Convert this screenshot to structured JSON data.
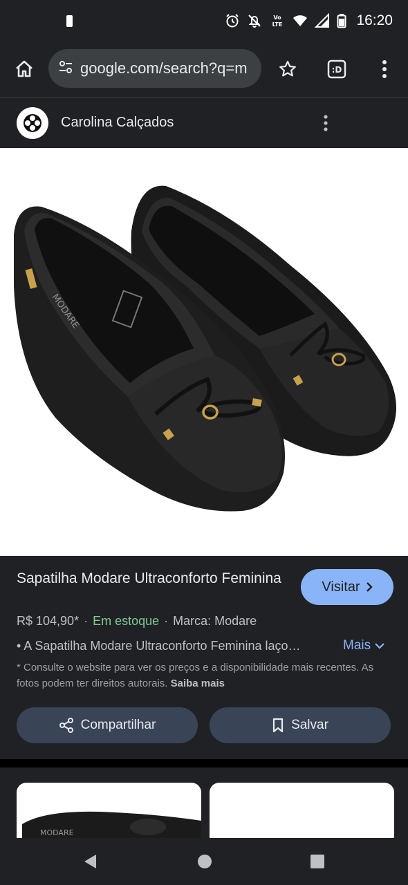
{
  "status_bar": {
    "time": "16:20",
    "network_label": "Vo LTE"
  },
  "browser": {
    "url": "google.com/search?q=m",
    "tab_label": ":D"
  },
  "site": {
    "name": "Carolina Calçados"
  },
  "product": {
    "title": "Sapatilha Modare Ultraconforto Feminina",
    "visit_label": "Visitar",
    "price": "R$ 104,90*",
    "separator": "·",
    "stock": "Em estoque",
    "brand": "Marca: Modare",
    "description": "• A Sapatilha Modare Ultraconforto Feminina laço…",
    "more_label": "Mais",
    "disclaimer": "* Consulte o website para ver os preços e a disponibilidade mais recentes. As fotos podem ter direitos autorais.",
    "learn_more": "Saiba mais",
    "share_label": "Compartilhar",
    "save_label": "Salvar",
    "image_brand_text": "MODARE"
  },
  "related": {
    "card1_brand": "MODARE"
  },
  "icons": {
    "home": "home-icon",
    "tune": "tune-icon",
    "star": "star-icon",
    "tabs": "tabs-icon",
    "menu": "more-vert-icon",
    "visit": "chevron-right-icon",
    "more": "chevron-down-icon",
    "share": "share-icon",
    "save": "bookmark-icon"
  },
  "colors": {
    "accent": "#8ab4f8",
    "stock": "#81c995",
    "panel": "#202124",
    "button": "#394457"
  }
}
